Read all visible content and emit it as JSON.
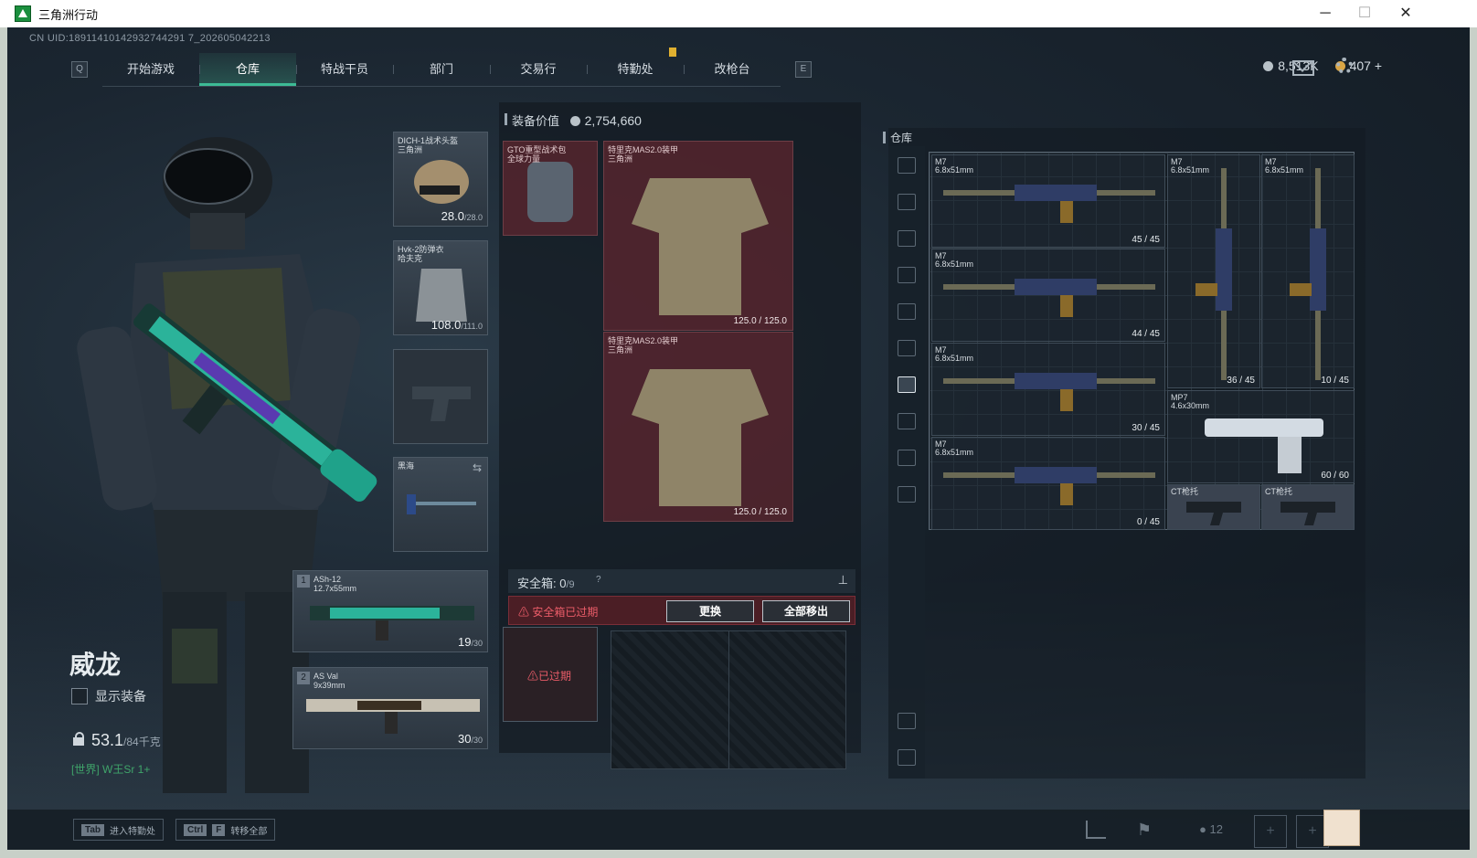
{
  "window": {
    "title": "三角洲行动",
    "minimize": "─",
    "maximize": "☐",
    "close": "✕"
  },
  "uid": "CN UID:18911410142932744291 7_202605042213",
  "nav": {
    "left_key": "Q",
    "right_key": "E",
    "tabs": [
      "开始游戏",
      "仓库",
      "特战干员",
      "部门",
      "交易行",
      "特勤处",
      "改枪台"
    ],
    "active": "仓库"
  },
  "currency": {
    "silver": "8,513K",
    "gold": "407",
    "plus": "+"
  },
  "character": {
    "name": "威龙",
    "show_equipment": "显示装备",
    "weight": "53.1",
    "weight_max": "/84千克",
    "chat": "[世界] W王Sr 1+"
  },
  "equip_slots": [
    {
      "name": "DICH-1战术头盔\n三角洲",
      "value": "28.0",
      "max": "/28.0"
    },
    {
      "name": "Hvk-2防弹衣\n哈夫克",
      "value": "108.0",
      "max": "/111.0"
    },
    {
      "name": "",
      "value": "",
      "max": ""
    },
    {
      "name": "黑海",
      "value": "",
      "max": ""
    },
    {
      "name": "ASh-12\n12.7x55mm",
      "num": "1",
      "value": "19",
      "max": "/30"
    },
    {
      "name": "AS Val\n9x39mm",
      "num": "2",
      "value": "30",
      "max": "/30"
    }
  ],
  "loadout": {
    "title": "装备价值",
    "value": "2,754,660",
    "items": [
      {
        "name": "GTO重型战术包\n全球力量",
        "value": ""
      },
      {
        "name": "特里克MAS2.0装甲\n三角洲",
        "value": "125.0 / 125.0"
      },
      {
        "name": "特里克MAS2.0装甲\n三角洲",
        "value": "125.0 / 125.0"
      }
    ]
  },
  "safebox": {
    "label": "安全箱:",
    "count": "0",
    "capacity": "/9",
    "help": "?",
    "expired_msg": "安全箱已过期",
    "replace": "更换",
    "move_all": "全部移出",
    "item_status": "已过期"
  },
  "storage": {
    "title": "仓库",
    "items": [
      {
        "name": "M7\n6.8x51mm",
        "ammo": "45 / 45"
      },
      {
        "name": "M7\n6.8x51mm",
        "ammo": "44 / 45"
      },
      {
        "name": "M7\n6.8x51mm",
        "ammo": "30 / 45"
      },
      {
        "name": "M7\n6.8x51mm",
        "ammo": "0 / 45"
      },
      {
        "name": "M7\n6.8x51mm",
        "ammo": "36 / 45"
      },
      {
        "name": "M7\n6.8x51mm",
        "ammo": "10 / 45"
      },
      {
        "name": "MP7\n4.6x30mm",
        "ammo": "60 / 60"
      },
      {
        "name": "CT枪托",
        "ammo": ""
      },
      {
        "name": "CT枪托",
        "ammo": ""
      }
    ]
  },
  "bottom": {
    "tab_key": "Tab",
    "tab_label": "进入特勤处",
    "ctrl_key": "Ctrl",
    "f_key": "F",
    "transfer_label": "转移全部",
    "friends": "12"
  }
}
